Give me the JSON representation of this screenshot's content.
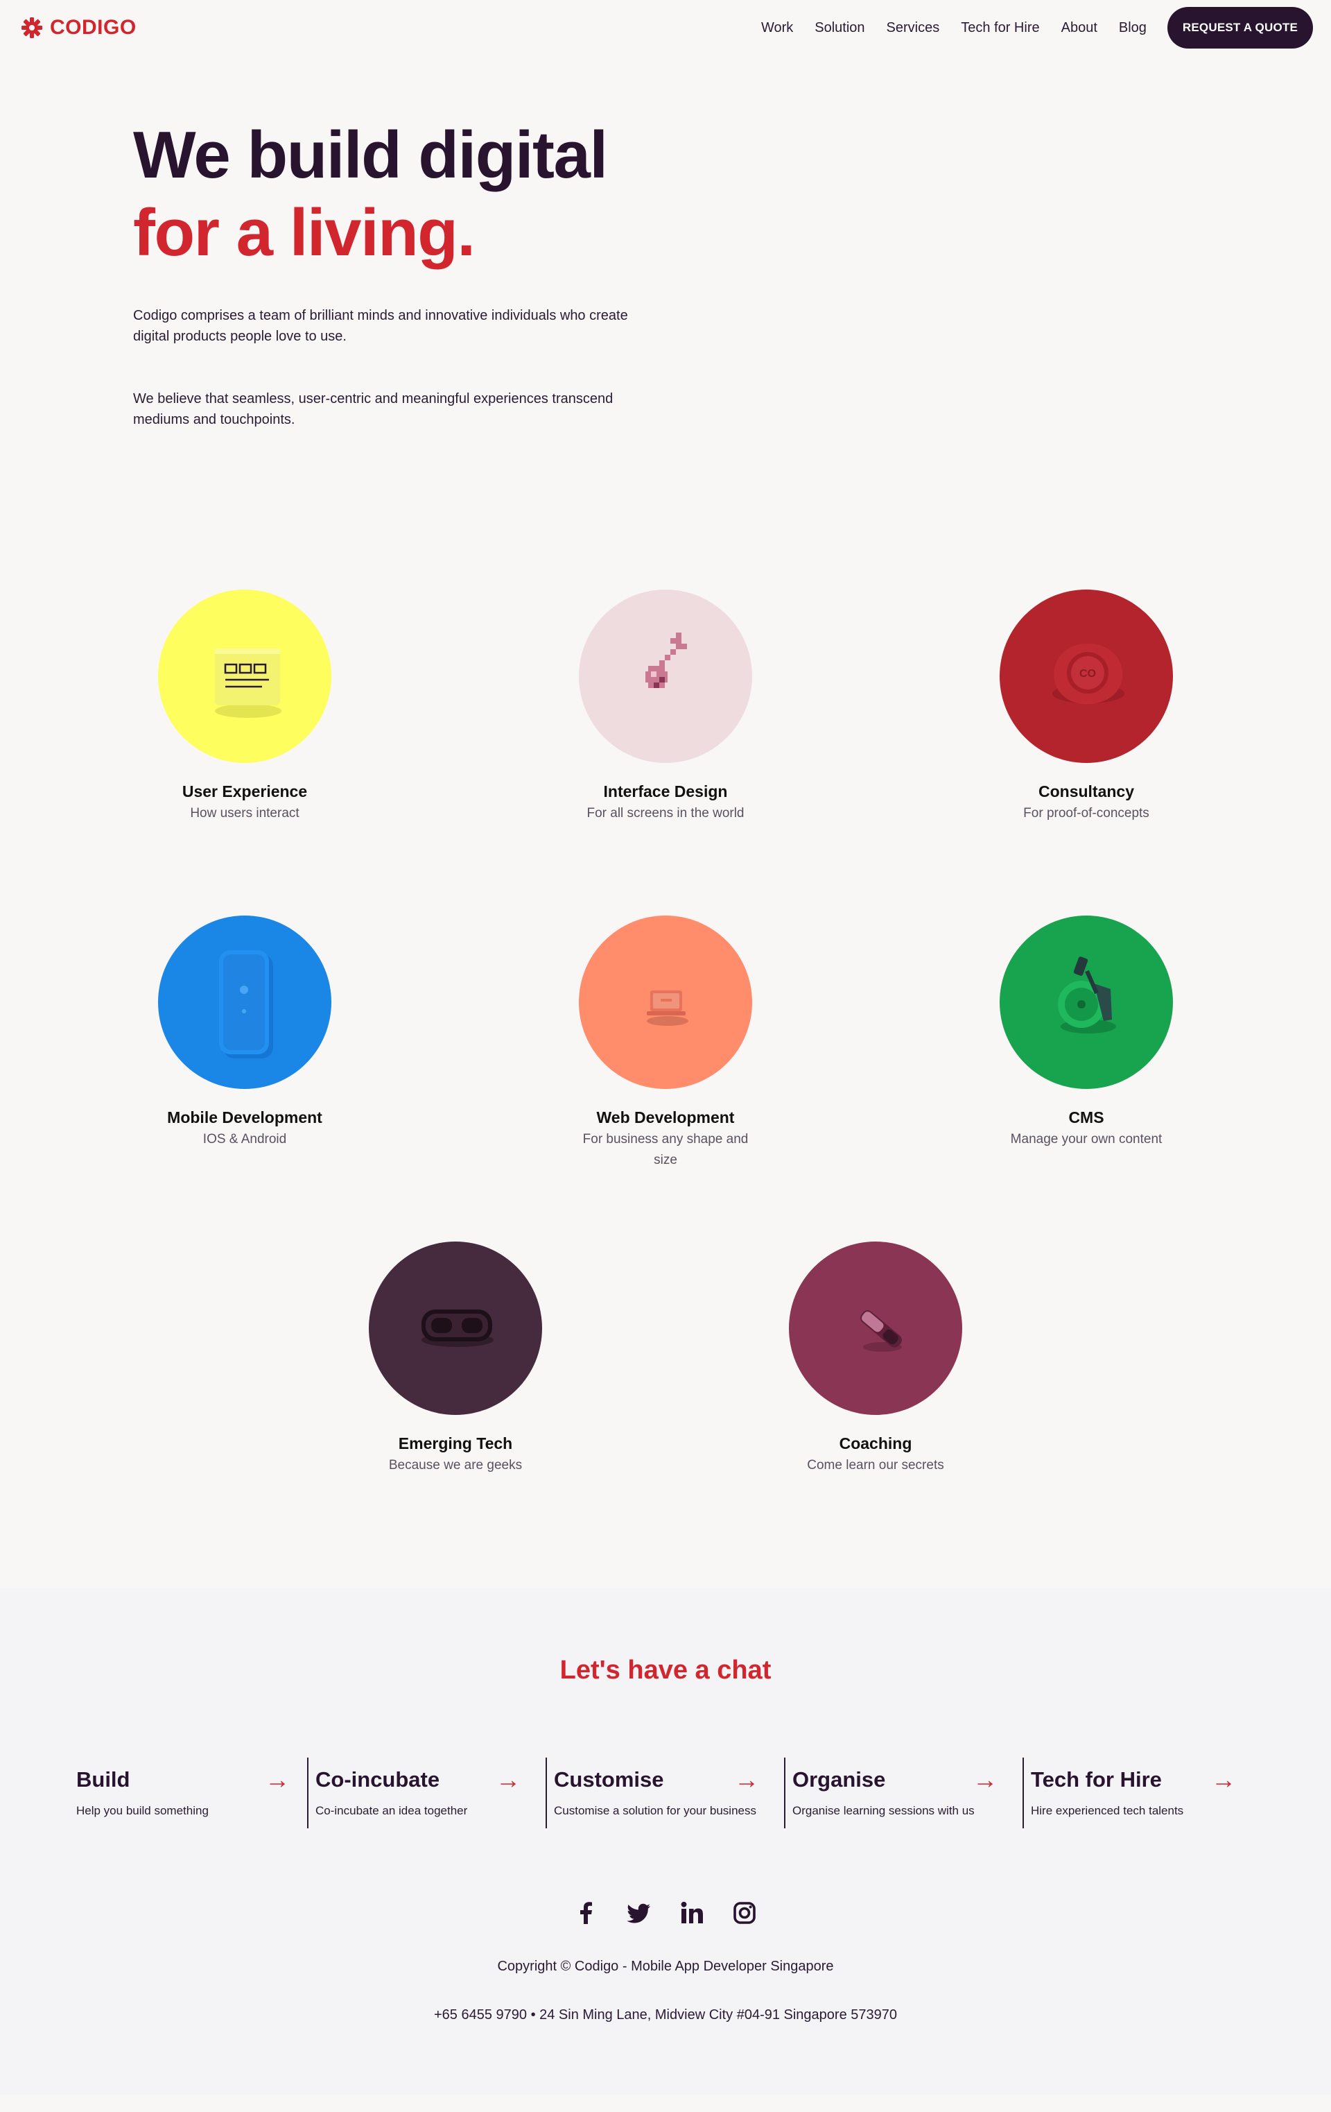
{
  "header": {
    "logo_text": "CODIGO",
    "nav": [
      "Work",
      "Solution",
      "Services",
      "Tech for Hire",
      "About",
      "Blog"
    ],
    "quote_button": "REQUEST A QUOTE"
  },
  "hero": {
    "title_line1": "We build digital",
    "title_line2": "for a living.",
    "paragraph1": "Codigo comprises a team of brilliant minds and innovative individuals who create digital products people love to use.",
    "paragraph2": "We believe that seamless, user-centric and meaningful experiences transcend mediums and touchpoints."
  },
  "services": [
    {
      "title": "User Experience",
      "desc": "How users interact",
      "color": "#fefe5e",
      "icon": "sticky-note-icon"
    },
    {
      "title": "Interface Design",
      "desc": "For all screens in the world",
      "color": "#efdcdf",
      "icon": "pixel-cherry-icon"
    },
    {
      "title": "Consultancy",
      "desc": "For proof-of-concepts",
      "color": "#b3242d",
      "icon": "wax-seal-icon"
    },
    {
      "title": "Mobile Development",
      "desc": "IOS & Android",
      "color": "#1a87e6",
      "icon": "smartphone-icon"
    },
    {
      "title": "Web Development",
      "desc": "For business any shape and size",
      "color": "#ff8c6b",
      "icon": "laptop-icon"
    },
    {
      "title": "CMS",
      "desc": "Manage your own content",
      "color": "#18a34f",
      "icon": "record-player-icon"
    },
    {
      "title": "Emerging Tech",
      "desc": "Because we are geeks",
      "color": "#452b3d",
      "icon": "vr-headset-icon"
    },
    {
      "title": "Coaching",
      "desc": "Come learn our secrets",
      "color": "#8a3553",
      "icon": "whistle-icon"
    }
  ],
  "chat": {
    "title": "Let's have a chat",
    "arrow": "→",
    "columns": [
      {
        "title": "Build",
        "desc": "Help you build something"
      },
      {
        "title": "Co-incubate",
        "desc": "Co-incubate an idea together"
      },
      {
        "title": "Customise",
        "desc": "Customise a solution for your business"
      },
      {
        "title": "Organise",
        "desc": "Organise learning sessions with us"
      },
      {
        "title": "Tech for Hire",
        "desc": "Hire experienced tech talents"
      }
    ]
  },
  "footer": {
    "socials": [
      "facebook-icon",
      "twitter-icon",
      "linkedin-icon",
      "instagram-icon"
    ],
    "copyright": "Copyright © Codigo - Mobile App Developer Singapore",
    "address": "+65 6455 9790 • 24 Sin Ming Lane, Midview City #04-91 Singapore 573970"
  },
  "colors": {
    "brand_red": "#d1262e",
    "dark_purple": "#28142f",
    "page_bg": "#f9f7f6",
    "footer_bg": "#f4f4f6"
  }
}
